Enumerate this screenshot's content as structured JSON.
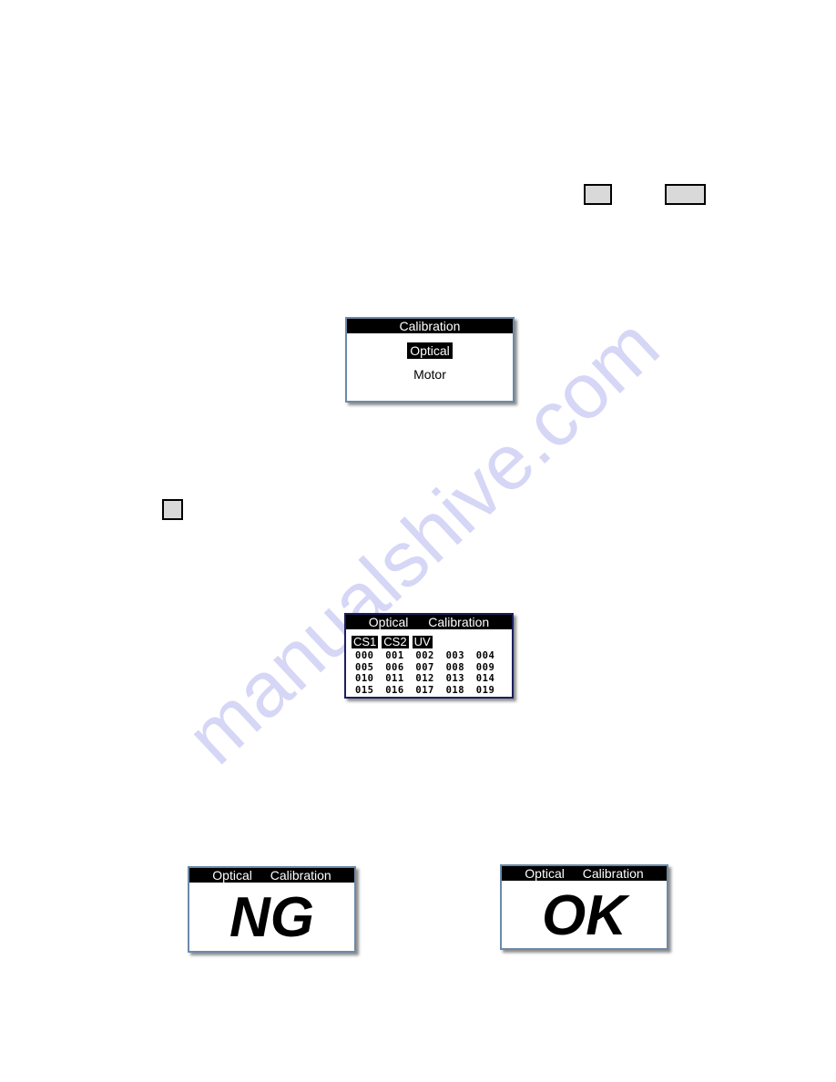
{
  "watermark": "manualshive.com",
  "keys": [
    {
      "name": "key-button-1",
      "label": ""
    },
    {
      "name": "key-button-2",
      "label": ""
    },
    {
      "name": "key-button-3",
      "label": ""
    }
  ],
  "menu_screen": {
    "title": "Calibration",
    "items": [
      {
        "label": "Optical",
        "selected": true
      },
      {
        "label": "Motor",
        "selected": false
      }
    ]
  },
  "grid_screen": {
    "title": "Optical Calibration",
    "tabs": [
      "CS1",
      "CS2",
      "UV"
    ],
    "cells": [
      "000",
      "001",
      "002",
      "003",
      "004",
      "005",
      "006",
      "007",
      "008",
      "009",
      "010",
      "011",
      "012",
      "013",
      "014",
      "015",
      "016",
      "017",
      "018",
      "019"
    ]
  },
  "ng_screen": {
    "title": "Optical Calibration",
    "result": "NG"
  },
  "ok_screen": {
    "title": "Optical Calibration",
    "result": "OK"
  },
  "colors": {
    "lcd_bg": "#ffffff",
    "lcd_title_bg": "#000000",
    "key_fill": "#d9d9d9",
    "watermark": "#cfd0f5"
  }
}
